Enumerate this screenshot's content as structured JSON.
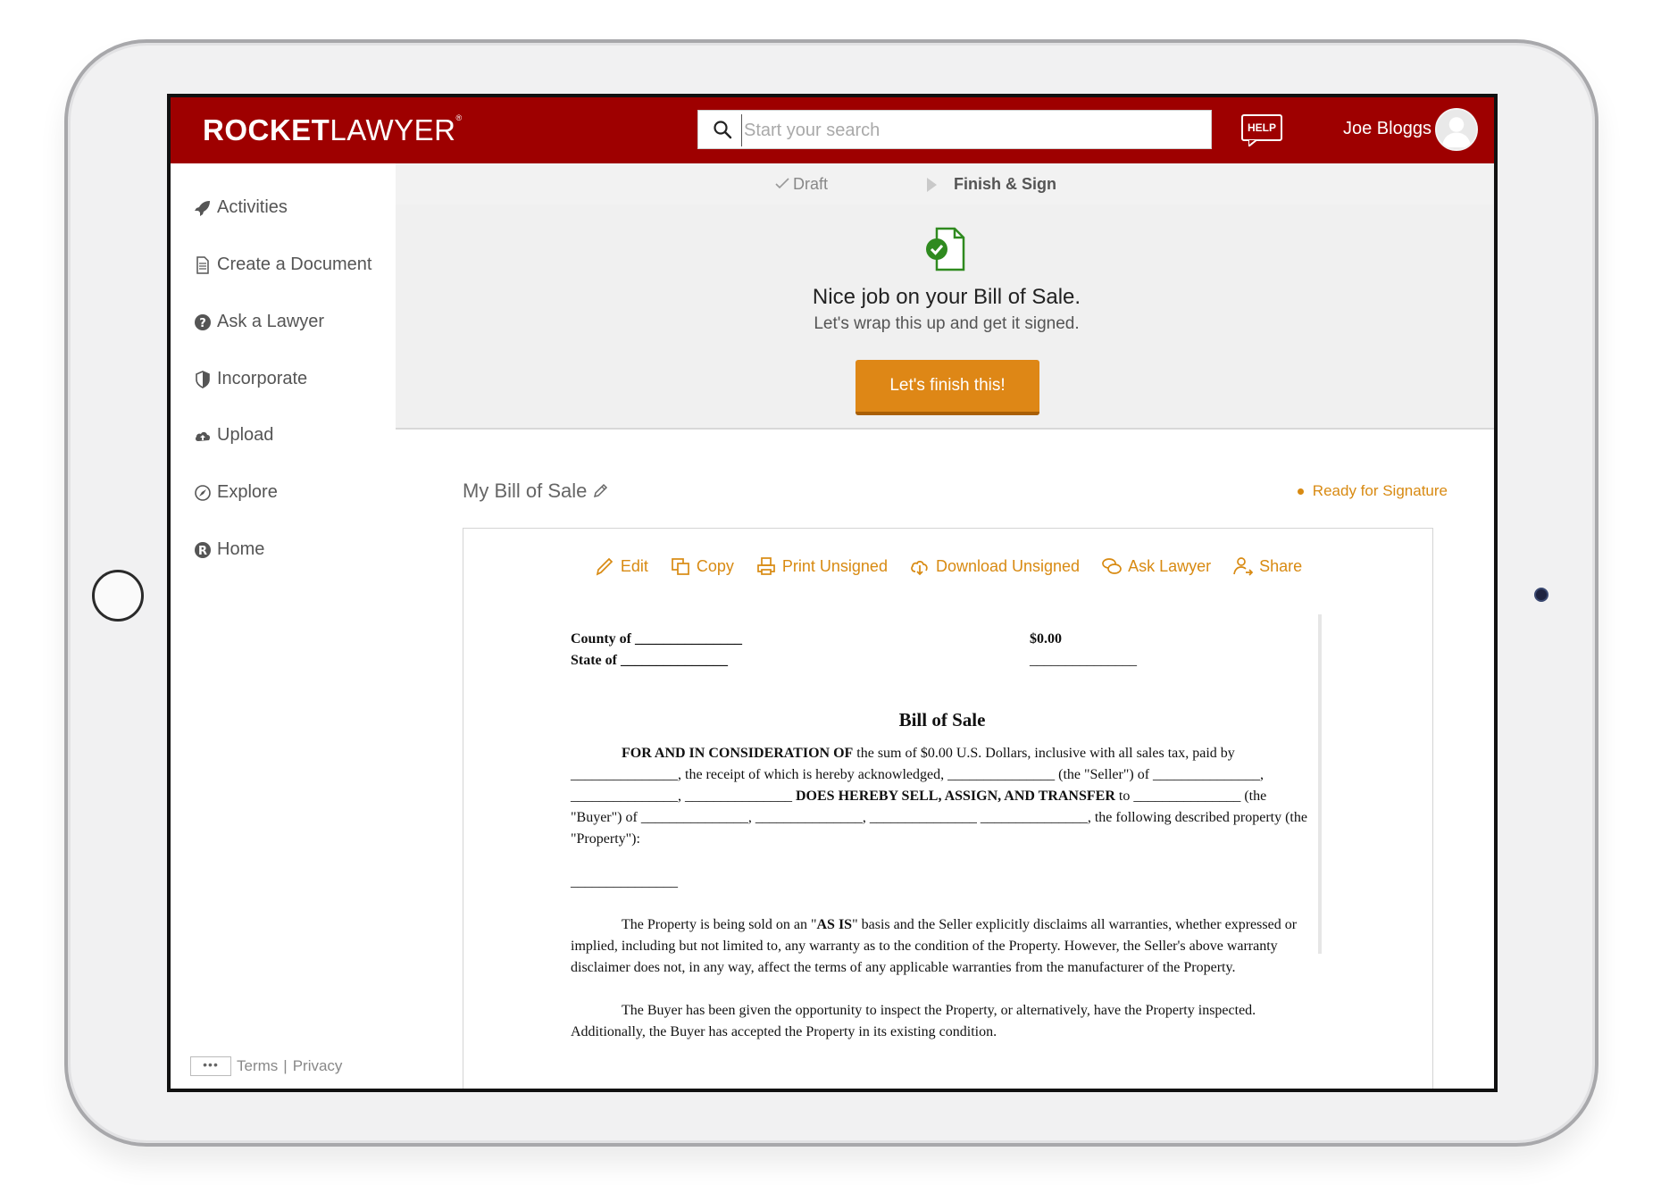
{
  "header": {
    "logo_bold": "ROCKET",
    "logo_light": "LAWYER",
    "logo_reg": "®",
    "search_placeholder": "Start your search",
    "help_label": "HELP",
    "username": "Joe Bloggs"
  },
  "sidebar": {
    "items": [
      {
        "label": "Activities",
        "icon": "rocket-icon"
      },
      {
        "label": "Create a Document",
        "icon": "document-icon"
      },
      {
        "label": "Ask a Lawyer",
        "icon": "question-icon"
      },
      {
        "label": "Incorporate",
        "icon": "shield-icon"
      },
      {
        "label": "Upload",
        "icon": "cloud-upload-icon"
      },
      {
        "label": "Explore",
        "icon": "compass-icon"
      },
      {
        "label": "Home",
        "icon": "rocketlawyer-logo-icon"
      }
    ],
    "footer": {
      "more": "•••",
      "terms": "Terms",
      "separator": "|",
      "privacy": "Privacy"
    }
  },
  "steps": {
    "draft": "Draft",
    "finish": "Finish & Sign"
  },
  "banner": {
    "title": "Nice job on your Bill of Sale.",
    "subtitle": "Let's wrap this up and get it signed.",
    "button": "Let's finish this!"
  },
  "document": {
    "name": "My Bill of Sale",
    "status": "Ready for Signature",
    "toolbar": [
      {
        "label": "Edit",
        "icon": "pencil-icon"
      },
      {
        "label": "Copy",
        "icon": "copy-icon"
      },
      {
        "label": "Print Unsigned",
        "icon": "print-icon"
      },
      {
        "label": "Download Unsigned",
        "icon": "download-icon"
      },
      {
        "label": "Ask Lawyer",
        "icon": "chat-icon"
      },
      {
        "label": "Share",
        "icon": "share-user-icon"
      }
    ],
    "body": {
      "county": "County of _______________",
      "state": "State of _______________",
      "amount": "$0.00",
      "amount_line": "_______________",
      "title": "Bill of Sale",
      "p1_bold": "FOR AND IN CONSIDERATION OF",
      "p1_text": " the sum of $0.00 U.S. Dollars, inclusive with all sales tax, paid by _______________, the receipt of which is hereby acknowledged, _______________ (the \"Seller\") of _______________, _______________, _______________ ",
      "p1_bold2": "DOES HEREBY SELL, ASSIGN, AND TRANSFER",
      "p1_text2": " to _______________ (the \"Buyer\") of _______________, _______________, _______________ _______________, the following described property (the \"Property\"):",
      "sig_line": "_______________",
      "p2_a": "The Property is being sold on an \"",
      "p2_bold": "AS IS",
      "p2_b": "\" basis and the Seller explicitly disclaims all warranties, whether expressed or implied, including but not limited to, any warranty as to the condition of the Property. However, the Seller's above warranty disclaimer does not, in any way, affect the terms of any applicable warranties from the manufacturer of the Property.",
      "p3": "The Buyer has been given the opportunity to inspect the Property, or alternatively, have the Property inspected. Additionally, the Buyer has accepted the Property in its existing condition."
    }
  },
  "colors": {
    "brand_red": "#9e0000",
    "accent_orange": "#de8716",
    "status_orange": "#d88a12",
    "success_green": "#2f8a1f"
  }
}
